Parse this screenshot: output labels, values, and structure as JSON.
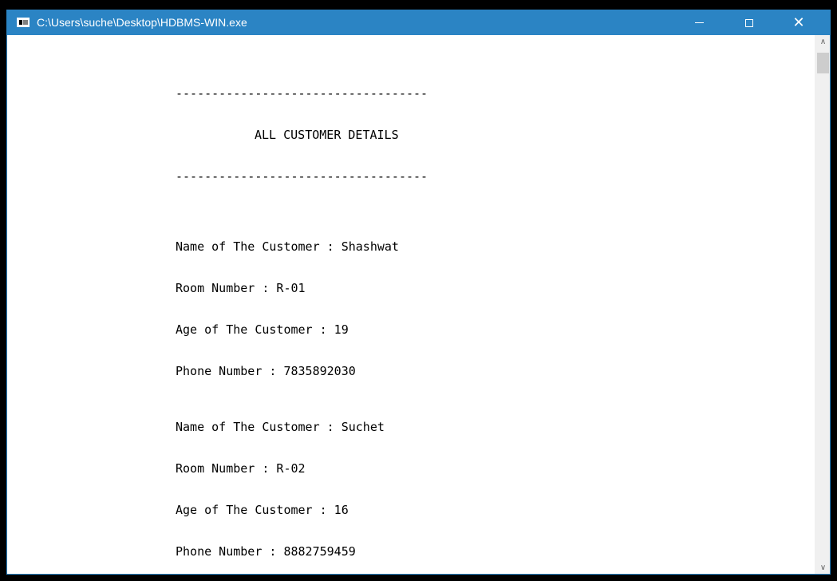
{
  "window": {
    "title": "C:\\Users\\suche\\Desktop\\HDBMS-WIN.exe",
    "icon": "console-app-icon",
    "controls": {
      "minimize": "minimize-icon",
      "maximize": "maximize-icon",
      "close": "close-icon"
    }
  },
  "console": {
    "separator": "-----------------------------------",
    "heading": "ALL CUSTOMER DETAILS",
    "customers": [
      {
        "name_line": "Name of The Customer : Shashwat",
        "room_line": "Room Number : R-01",
        "age_line": "Age of The Customer : 19",
        "phone_line": "Phone Number : 7835892030"
      },
      {
        "name_line": "Name of The Customer : Suchet",
        "room_line": "Room Number : R-02",
        "age_line": "Age of The Customer : 16",
        "phone_line": "Phone Number : 8882759459"
      }
    ]
  },
  "scrollbar": {
    "up_icon": "scroll-up-arrow-icon",
    "down_icon": "scroll-down-arrow-icon"
  },
  "colors": {
    "titlebar": "#2b84c4",
    "console_bg": "#ffffff",
    "console_text": "#000000"
  }
}
